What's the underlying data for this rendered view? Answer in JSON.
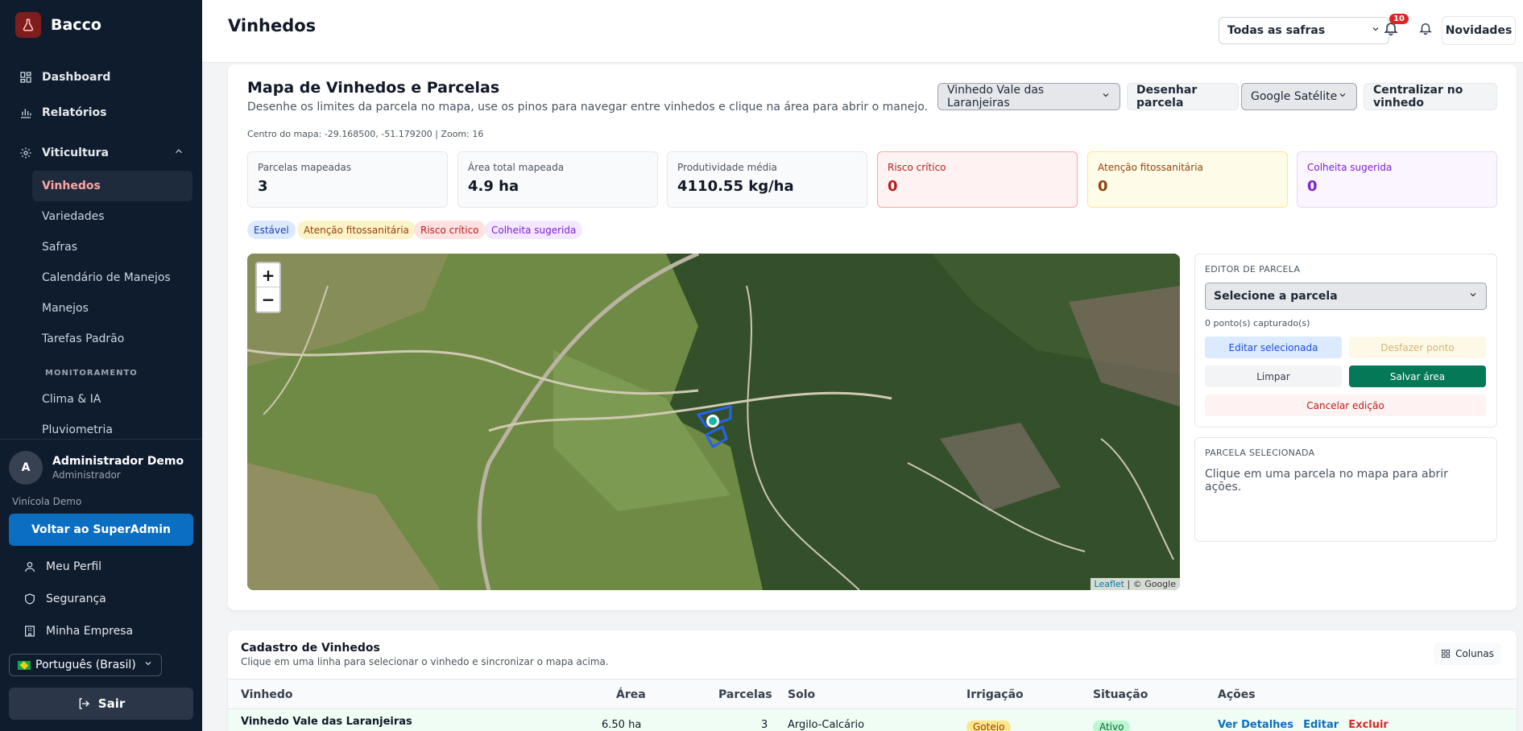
{
  "brand": {
    "name": "Bacco"
  },
  "sidebar": {
    "items": [
      {
        "label": "Dashboard"
      },
      {
        "label": "Relatórios"
      },
      {
        "label": "Viticultura"
      }
    ],
    "sub": [
      {
        "label": "Vinhedos"
      },
      {
        "label": "Variedades"
      },
      {
        "label": "Safras"
      },
      {
        "label": "Calendário de Manejos"
      },
      {
        "label": "Manejos"
      },
      {
        "label": "Tarefas Padrão"
      }
    ],
    "section": "MONITORAMENTO",
    "sub2": [
      {
        "label": "Clima & IA"
      },
      {
        "label": "Pluviometria"
      }
    ]
  },
  "footer": {
    "avatar_initial": "A",
    "user_name": "Administrador Demo",
    "user_role": "Administrador",
    "company": "Vinícola Demo",
    "superadmin": "Voltar ao SuperAdmin",
    "links": [
      {
        "label": "Meu Perfil"
      },
      {
        "label": "Segurança"
      },
      {
        "label": "Minha Empresa"
      }
    ],
    "language": "Português (Brasil)",
    "logout": "Sair"
  },
  "header": {
    "title": "Vinhedos",
    "safra": "Todas as safras",
    "notif_count": "10",
    "news": "Novidades"
  },
  "map_card": {
    "title": "Mapa de Vinhedos e Parcelas",
    "subtitle": "Desenhe os limites da parcela no mapa, use os pinos para navegar entre vinhedos e clique na área para abrir o manejo.",
    "center_info": "Centro do mapa: -29.168500, -51.179200 | Zoom: 16",
    "vineyard_select": "Vinhedo Vale das Laranjeiras",
    "draw": "Desenhar parcela",
    "layer_select": "Google Satélite",
    "center": "Centralizar no vinhedo",
    "stats": [
      {
        "label": "Parcelas mapeadas",
        "value": "3"
      },
      {
        "label": "Área total mapeada",
        "value": "4.9 ha"
      },
      {
        "label": "Produtividade média",
        "value": "4110.55 kg/ha"
      },
      {
        "label": "Risco crítico",
        "value": "0"
      },
      {
        "label": "Atenção fitossanitária",
        "value": "0"
      },
      {
        "label": "Colheita sugerida",
        "value": "0"
      }
    ],
    "legend": [
      "Estável",
      "Atenção fitossanitária",
      "Risco crítico",
      "Colheita sugerida"
    ],
    "zoom_in": "+",
    "zoom_out": "−",
    "attrib_leaflet": "Leaflet",
    "attrib_rest": " | © Google"
  },
  "editor": {
    "title": "EDITOR DE PARCELA",
    "select": "Selecione a parcela",
    "points": "0 ponto(s) capturado(s)",
    "edit": "Editar selecionada",
    "undo": "Desfazer ponto",
    "clear": "Limpar",
    "save": "Salvar área",
    "cancel": "Cancelar edição"
  },
  "selected": {
    "title": "PARCELA SELECIONADA",
    "text": "Clique em uma parcela no mapa para abrir ações."
  },
  "table": {
    "title": "Cadastro de Vinhedos",
    "subtitle": "Clique em uma linha para selecionar o vinhedo e sincronizar o mapa acima.",
    "columns_btn": "Colunas",
    "headers": [
      "Vinhedo",
      "Área",
      "Parcelas",
      "Solo",
      "Irrigação",
      "Situação",
      "Ações"
    ],
    "rows": [
      {
        "vinhedo": "Vinhedo Vale das Laranjeiras",
        "area": "6.50 ha",
        "parcelas": "3",
        "solo": "Argilo-Calcário",
        "irrigacao": "Gotejo",
        "situacao": "Ativo",
        "acao1": "Ver Detalhes",
        "acao2": "Editar",
        "acao3": "Excluir"
      }
    ]
  },
  "colors": {
    "accent": "#0b6ec1",
    "sidebar": "#0f1c2e",
    "save": "#047857"
  }
}
